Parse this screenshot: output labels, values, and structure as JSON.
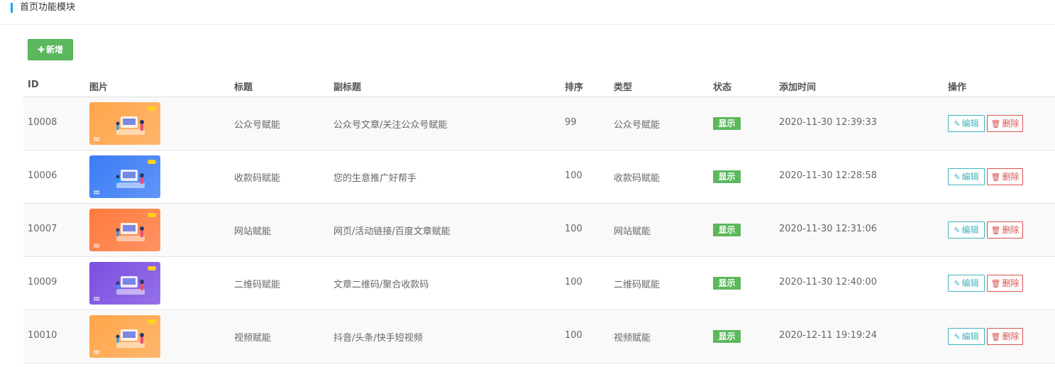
{
  "header": {
    "title": "首页功能模块"
  },
  "toolbar": {
    "add_label": "新增",
    "add_icon": "plus-icon"
  },
  "table": {
    "columns": [
      "ID",
      "图片",
      "标题",
      "副标题",
      "排序",
      "类型",
      "状态",
      "添加时间",
      "操作"
    ],
    "rows": [
      {
        "id": "10008",
        "title": "公众号赋能",
        "subtitle": "公众号文章/关注公众号赋能",
        "sort": "99",
        "type": "公众号赋能",
        "status": "显示",
        "added": "2020-11-30 12:39:33",
        "thumb_color": "#ffa54a"
      },
      {
        "id": "10006",
        "title": "收款码赋能",
        "subtitle": "您的生意推广好帮手",
        "sort": "100",
        "type": "收款码赋能",
        "status": "显示",
        "added": "2020-11-30 12:28:58",
        "thumb_color": "#3a7bf5"
      },
      {
        "id": "10007",
        "title": "网站赋能",
        "subtitle": "网页/活动链接/百度文章赋能",
        "sort": "100",
        "type": "网站赋能",
        "status": "显示",
        "added": "2020-11-30 12:31:06",
        "thumb_color": "#ff7a3d"
      },
      {
        "id": "10009",
        "title": "二维码赋能",
        "subtitle": "文章二维码/聚合收款码",
        "sort": "100",
        "type": "二维码赋能",
        "status": "显示",
        "added": "2020-11-30 12:40:00",
        "thumb_color": "#7a4ee0"
      },
      {
        "id": "10010",
        "title": "视频赋能",
        "subtitle": "抖音/头条/快手短视频",
        "sort": "100",
        "type": "视频赋能",
        "status": "显示",
        "added": "2020-12-11 19:19:24",
        "thumb_color": "#ffa54a"
      }
    ],
    "actions": {
      "edit_label": "编辑",
      "delete_label": "删除",
      "edit_icon": "pencil-icon",
      "delete_icon": "trash-icon"
    }
  },
  "colors": {
    "accent": "#1e9fff",
    "success": "#5cb85c",
    "edit": "#3fb4c1",
    "danger": "#d9534f"
  }
}
